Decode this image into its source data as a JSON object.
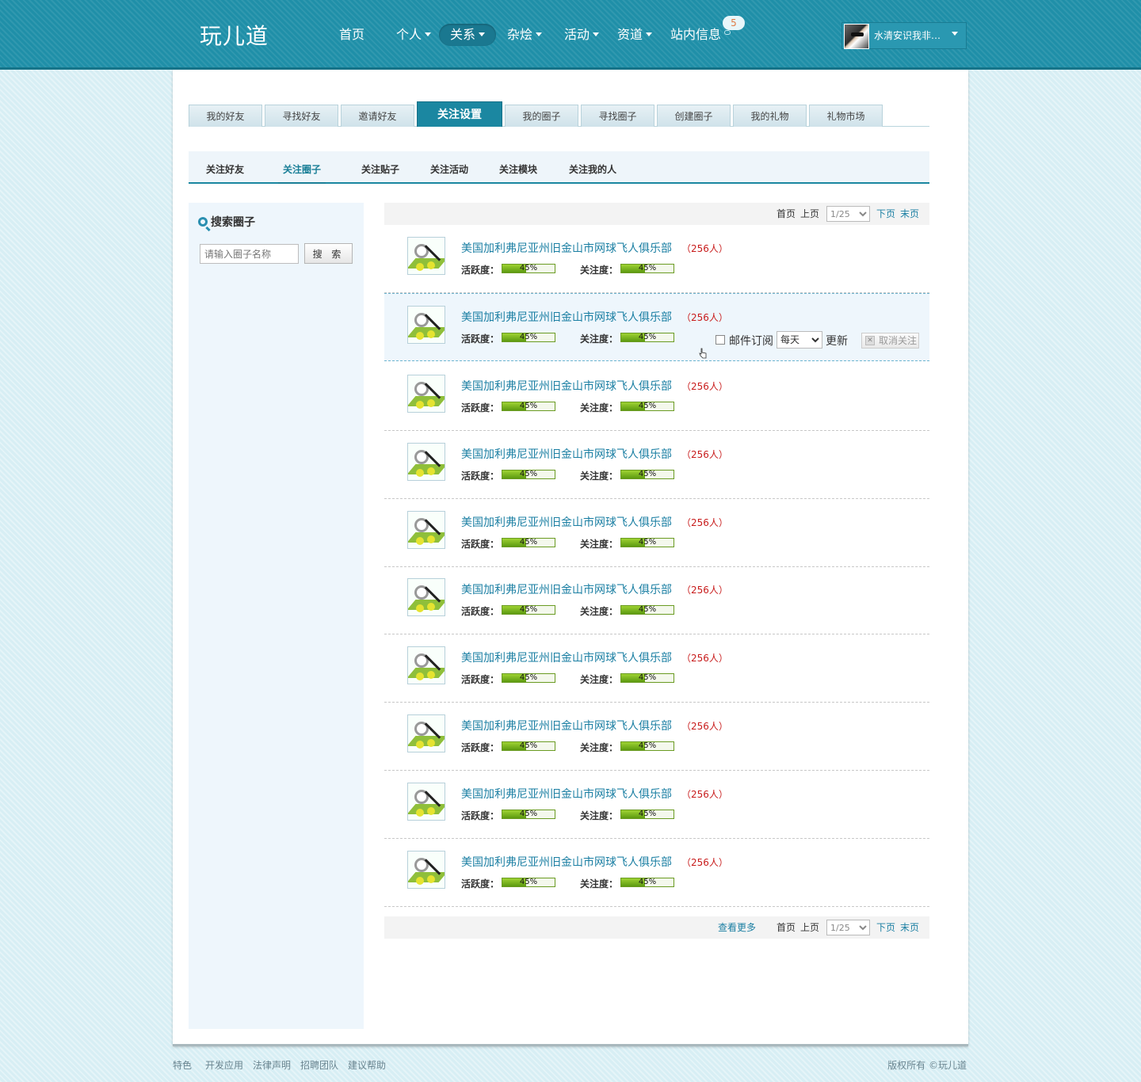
{
  "brand": {
    "logo": "玩儿道"
  },
  "nav": {
    "items": [
      {
        "label": "首页"
      },
      {
        "label": "个人"
      },
      {
        "label": "关系"
      },
      {
        "label": "杂烩"
      },
      {
        "label": "活动"
      },
      {
        "label": "资道"
      },
      {
        "label": "站内信息"
      }
    ],
    "message_badge": "5"
  },
  "user": {
    "name": "水清安识我非…"
  },
  "tabs": [
    {
      "label": "我的好友"
    },
    {
      "label": "寻找好友"
    },
    {
      "label": "邀请好友"
    },
    {
      "label": "关注设置"
    },
    {
      "label": "我的圈子"
    },
    {
      "label": "寻找圈子"
    },
    {
      "label": "创建圈子"
    },
    {
      "label": "我的礼物"
    },
    {
      "label": "礼物市场"
    }
  ],
  "subtabs": [
    {
      "label": "关注好友"
    },
    {
      "label": "关注圈子"
    },
    {
      "label": "关注贴子"
    },
    {
      "label": "关注活动"
    },
    {
      "label": "关注模块"
    },
    {
      "label": "关注我的人"
    }
  ],
  "sidebar": {
    "title": "搜索圈子",
    "search_placeholder": "请输入圈子名称",
    "search_button": "搜 索"
  },
  "pager": {
    "first": "首页",
    "prev": "上页",
    "page_value": "1/25",
    "next": "下页",
    "last": "末页",
    "more": "查看更多"
  },
  "labels": {
    "activity": "活跃度：",
    "attention": "关注度：",
    "mail_subscribe": "邮件订阅",
    "freq_value": "每天",
    "update": "更新",
    "unfollow": "取消关注"
  },
  "circles": [
    {
      "name": "美国加利弗尼亚州旧金山市网球飞人俱乐部",
      "members": "（256人）",
      "activity_pct": 45,
      "activity_text": "45%",
      "attention_pct": 45,
      "attention_text": "45%"
    },
    {
      "name": "美国加利弗尼亚州旧金山市网球飞人俱乐部",
      "members": "（256人）",
      "activity_pct": 45,
      "activity_text": "45%",
      "attention_pct": 45,
      "attention_text": "45%"
    },
    {
      "name": "美国加利弗尼亚州旧金山市网球飞人俱乐部",
      "members": "（256人）",
      "activity_pct": 45,
      "activity_text": "45%",
      "attention_pct": 45,
      "attention_text": "45%"
    },
    {
      "name": "美国加利弗尼亚州旧金山市网球飞人俱乐部",
      "members": "（256人）",
      "activity_pct": 45,
      "activity_text": "45%",
      "attention_pct": 45,
      "attention_text": "45%"
    },
    {
      "name": "美国加利弗尼亚州旧金山市网球飞人俱乐部",
      "members": "（256人）",
      "activity_pct": 45,
      "activity_text": "45%",
      "attention_pct": 45,
      "attention_text": "45%"
    },
    {
      "name": "美国加利弗尼亚州旧金山市网球飞人俱乐部",
      "members": "（256人）",
      "activity_pct": 45,
      "activity_text": "45%",
      "attention_pct": 45,
      "attention_text": "45%"
    },
    {
      "name": "美国加利弗尼亚州旧金山市网球飞人俱乐部",
      "members": "（256人）",
      "activity_pct": 45,
      "activity_text": "45%",
      "attention_pct": 45,
      "attention_text": "45%"
    },
    {
      "name": "美国加利弗尼亚州旧金山市网球飞人俱乐部",
      "members": "（256人）",
      "activity_pct": 45,
      "activity_text": "45%",
      "attention_pct": 45,
      "attention_text": "45%"
    },
    {
      "name": "美国加利弗尼亚州旧金山市网球飞人俱乐部",
      "members": "（256人）",
      "activity_pct": 45,
      "activity_text": "45%",
      "attention_pct": 45,
      "attention_text": "45%"
    },
    {
      "name": "美国加利弗尼亚州旧金山市网球飞人俱乐部",
      "members": "（256人）",
      "activity_pct": 45,
      "activity_text": "45%",
      "attention_pct": 45,
      "attention_text": "45%"
    }
  ],
  "footer": {
    "links": [
      {
        "label": "特色"
      },
      {
        "label": "开发应用"
      },
      {
        "label": "法律声明"
      },
      {
        "label": "招聘团队"
      },
      {
        "label": "建议帮助"
      }
    ],
    "copyright": "版权所有 ©玩儿道"
  },
  "colors": {
    "header": "#1f8fa8",
    "accent": "#1b87a1",
    "link": "#1b7fa3",
    "count_red": "#c81c1c",
    "bar_green": "#7bb821"
  }
}
